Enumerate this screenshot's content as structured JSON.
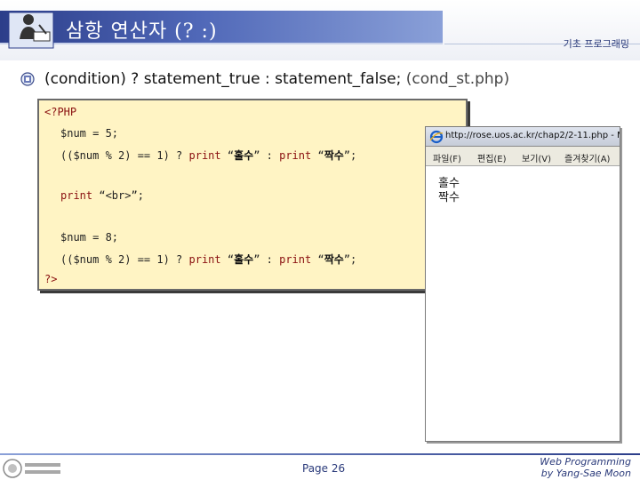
{
  "header": {
    "title": "삼항 연산자 (? :)",
    "right_label": "기초 프로그래밍",
    "icon": "person-at-desk-icon"
  },
  "bullet": {
    "icon": "bullet-icon",
    "syntax": "(condition) ? statement_true : statement_false;",
    "file": "(cond_st.php)"
  },
  "code": {
    "open_tag": "<?PHP",
    "line1": "$num = 5;",
    "line2_pre": "(($num % 2) == 1) ? ",
    "print_kw": "print",
    "odd_quote_open": "“",
    "odd": "홀수",
    "odd_quote_close": "”",
    "mid": " : ",
    "even_quote_open": "“",
    "even": "짝수",
    "even_quote_close": "”;",
    "line3_kw": "print",
    "line3_rest": " “<br>”;",
    "line4": "$num = 8;",
    "close_tag": "?>"
  },
  "browser": {
    "ie_icon": "internet-explorer-icon",
    "url": "http://rose.uos.ac.kr/chap2/2-11.php - M",
    "menu": [
      "파일(F)",
      "편집(E)",
      "보기(V)",
      "즐겨찾기(A)"
    ],
    "output": [
      "홀수",
      "짝수"
    ]
  },
  "footer": {
    "logo": "university-logo",
    "page": "Page 26",
    "credit_line1": "Web Programming",
    "credit_line2": "by Yang-Sae Moon"
  }
}
